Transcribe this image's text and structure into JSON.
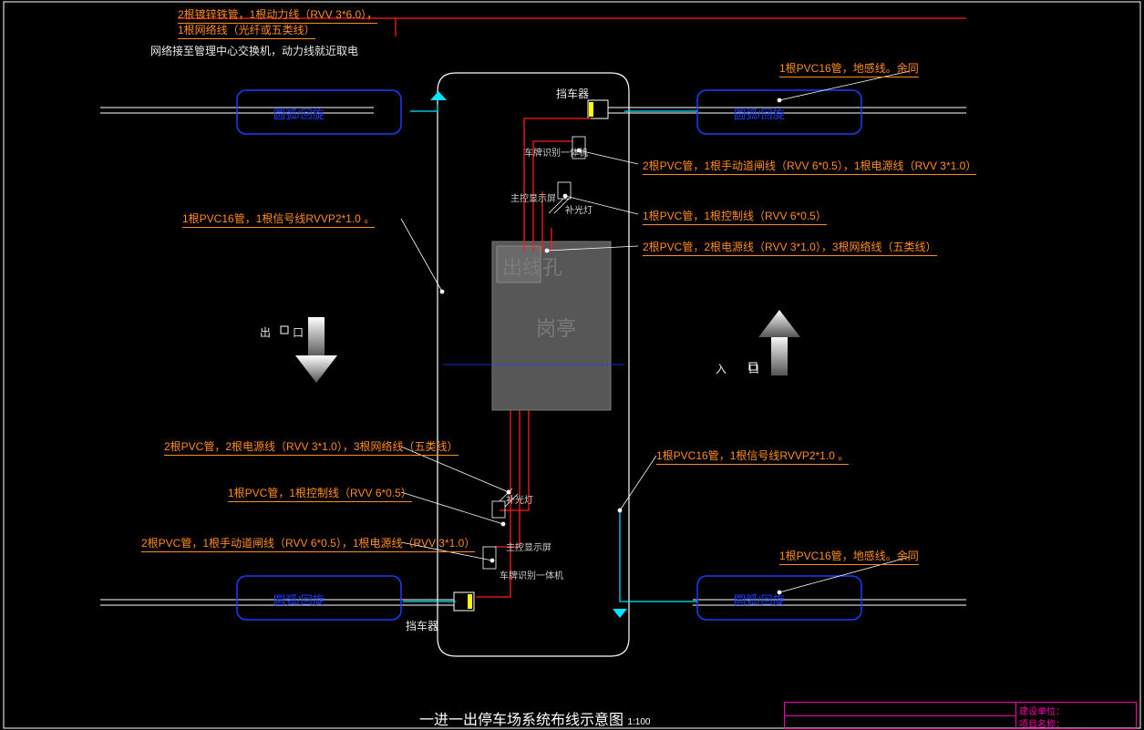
{
  "title": "一进一出停车场系统布线示意图",
  "scale": "1:100",
  "labels": {
    "top1": "2根镀锌铁管，1根动力线（RVV 3*6.0），",
    "top2": "1根网络线（光纤或五类线）",
    "netnote": "网络接至管理中心交换机，动力线就近取电",
    "pvc16_ground_r1": "1根PVC16管，地感线。余同",
    "barrier": "挡车器",
    "camera_unit": "车牌识别一体机",
    "display_unit": "主控显示屏",
    "fill_light": "补光灯",
    "pvc16_sig_l": "1根PVC16管，1根信号线RVVP2*1.0 。",
    "r_line1": "2根PVC管，1根手动道闸线（RVV 6*0.5），1根电源线（RVV 3*1.0）",
    "r_line2": "1根PVC管，1根控制线（RVV 6*0.5）",
    "r_line3": "2根PVC管，2根电源线（RVV 3*1.0），3根网络线（五类线）",
    "outhole": "出线孔",
    "booth": "岗亭",
    "exit": "出　口",
    "entry": "入　口",
    "pvc16_sig_r": "1根PVC16管，1根信号线RVVP2*1.0 。",
    "l_line1": "2根PVC管，2根电源线（RVV 3*1.0），3根网络线（五类线）",
    "l_line2": "1根PVC管，1根控制线（RVV 6*0.5）",
    "l_line3": "2根PVC管，1根手动道闸线（RVV 6*0.5），1根电源线（RVV 3*1.0）",
    "pvc16_ground_r2": "1根PVC16管，地感线。余同",
    "loopbox": "圆弧/回旋"
  },
  "titleblock": {
    "owner": "建设单位：",
    "project": "项目名称："
  }
}
